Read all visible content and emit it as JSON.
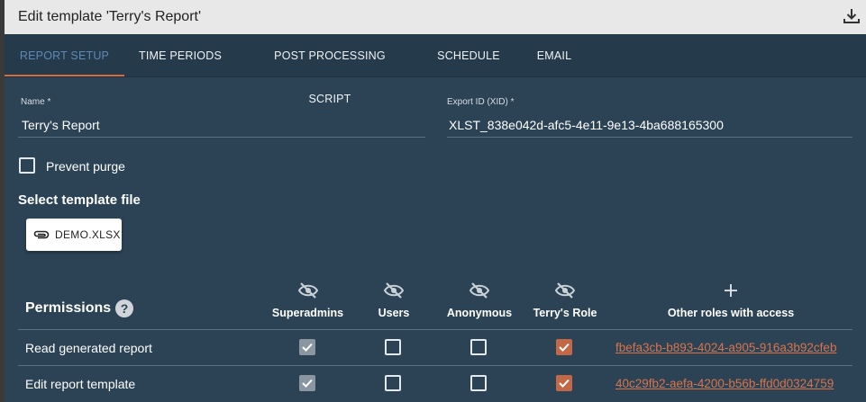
{
  "window": {
    "title": "Edit template 'Terry's Report'",
    "download_icon": "download-icon"
  },
  "tabs": [
    {
      "label": "REPORT SETUP",
      "active": true
    },
    {
      "label": "TIME PERIODS",
      "active": false
    },
    {
      "label": "POST PROCESSING SCRIPT",
      "active": false
    },
    {
      "label": "SCHEDULE",
      "active": false
    },
    {
      "label": "EMAIL",
      "active": false
    }
  ],
  "form": {
    "name_label": "Name *",
    "name_value": "Terry's Report",
    "xid_label": "Export ID (XID) *",
    "xid_value": "XLST_838e042d-afc5-4e11-9e13-4ba688165300",
    "prevent_purge_label": "Prevent purge",
    "prevent_purge_checked": false,
    "template_section": "Select template file",
    "template_file": "DEMO.XLSX",
    "template_icon": "paperclip-icon"
  },
  "permissions": {
    "title": "Permissions",
    "help": "?",
    "columns": [
      {
        "label": "Superadmins",
        "icon": "eye-off-icon"
      },
      {
        "label": "Users",
        "icon": "eye-off-icon"
      },
      {
        "label": "Anonymous",
        "icon": "eye-off-icon"
      },
      {
        "label": "Terry's Role",
        "icon": "eye-off-icon"
      },
      {
        "label": "Other roles with access",
        "icon": "plus-icon"
      }
    ],
    "rows": [
      {
        "label": "Read generated report",
        "superadmins": "checked-disabled",
        "users": false,
        "anonymous": false,
        "terrys_role": true,
        "other_roles": "fbefa3cb-b893-4024-a905-916a3b92cfeb"
      },
      {
        "label": "Edit report template",
        "superadmins": "checked-disabled",
        "users": false,
        "anonymous": false,
        "terrys_role": true,
        "other_roles": "40c29fb2-aefa-4200-b56b-ffd0d0324759"
      }
    ]
  },
  "colors": {
    "panel": "#2c4356",
    "tab_bar": "#253a4b",
    "active_tab": "#5b8bb6",
    "accent": "#d46a3c",
    "checkbox_checked": "#c36846",
    "link": "#d9734a"
  }
}
